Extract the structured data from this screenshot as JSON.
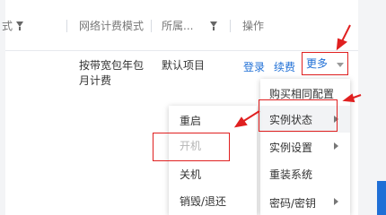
{
  "table": {
    "headers": {
      "partial_col": "式",
      "billing_mode": "网络计费模式",
      "project": "所属...",
      "actions": "操作"
    },
    "row": {
      "billing_mode_line1": "按带宽包年包",
      "billing_mode_line2": "月计费",
      "project": "默认项目",
      "action_login": "登录",
      "action_renew": "续费",
      "action_more": "更多"
    }
  },
  "more_menu": {
    "items": [
      {
        "label": "购买相同配置",
        "has_submenu": false
      },
      {
        "label": "实例状态",
        "has_submenu": true
      },
      {
        "label": "实例设置",
        "has_submenu": true
      },
      {
        "label": "重装系统",
        "has_submenu": false
      },
      {
        "label": "密码/密钥",
        "has_submenu": true
      }
    ]
  },
  "status_submenu": {
    "items": [
      {
        "label": "重启",
        "disabled": false
      },
      {
        "label": "开机",
        "disabled": true
      },
      {
        "label": "关机",
        "disabled": false
      },
      {
        "label": "销毁/退还",
        "disabled": false
      }
    ]
  },
  "colors": {
    "link": "#1f6fd6",
    "annotation": "#e02020",
    "disabled_text": "#b5b5b5"
  }
}
